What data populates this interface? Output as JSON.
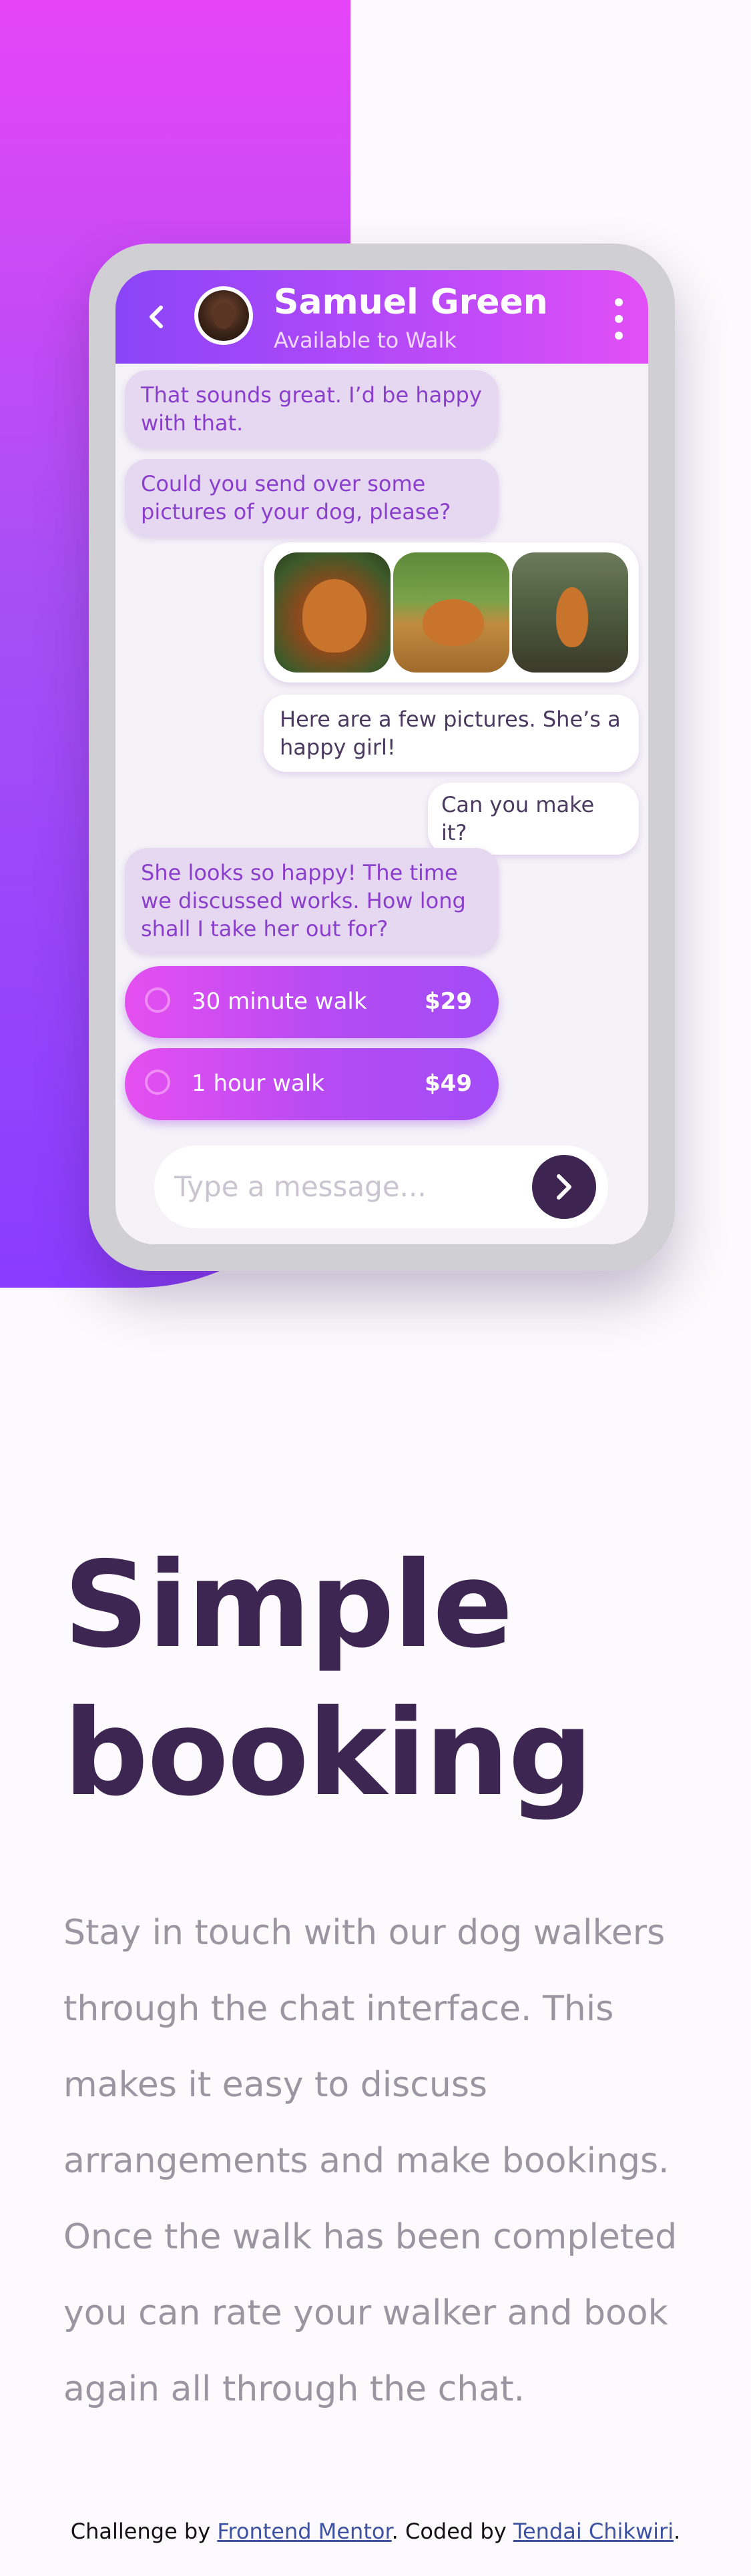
{
  "chat": {
    "contact_name": "Samuel Green",
    "contact_status": "Available to Walk",
    "messages": [
      {
        "from": "walker",
        "text": "That sounds great. I’d be happy with that."
      },
      {
        "from": "walker",
        "text": "Could you send over some pictures of your dog, please?"
      },
      {
        "from": "user",
        "text": "Here are a few pictures. She’s a happy girl!"
      },
      {
        "from": "user",
        "text": "Can you make it?"
      },
      {
        "from": "walker",
        "text": "She looks so happy! The time we discussed works. How long shall I take her out for?"
      }
    ],
    "options": [
      {
        "label": "30 minute walk",
        "price": "$29"
      },
      {
        "label": "1 hour walk",
        "price": "$49"
      }
    ],
    "input_placeholder": "Type a message...",
    "icons": {
      "back": "chevron-left-icon",
      "menu": "vertical-dots-icon",
      "send": "chevron-right-icon",
      "radio": "radio-circle-icon"
    }
  },
  "hero": {
    "heading_line1": "Simple",
    "heading_line2": "booking",
    "body": "Stay in touch with our dog walkers through the chat interface. This makes it easy to discuss arrangements and make bookings. Once the walk has been completed you can rate your walker and book again all through the chat."
  },
  "attribution": {
    "prefix": "Challenge by ",
    "link1": "Frontend Mentor",
    "middle": ". Coded by ",
    "link2": "Tendai Chikwiri",
    "suffix": "."
  },
  "colors": {
    "gradient_start": "#e645f7",
    "gradient_end": "#8a3cff",
    "heading": "#3e2653",
    "body_text": "#9a96a1",
    "incoming_bubble": "#e7d8f1",
    "incoming_text": "#8a3fcc",
    "send_button": "#3d2451"
  }
}
